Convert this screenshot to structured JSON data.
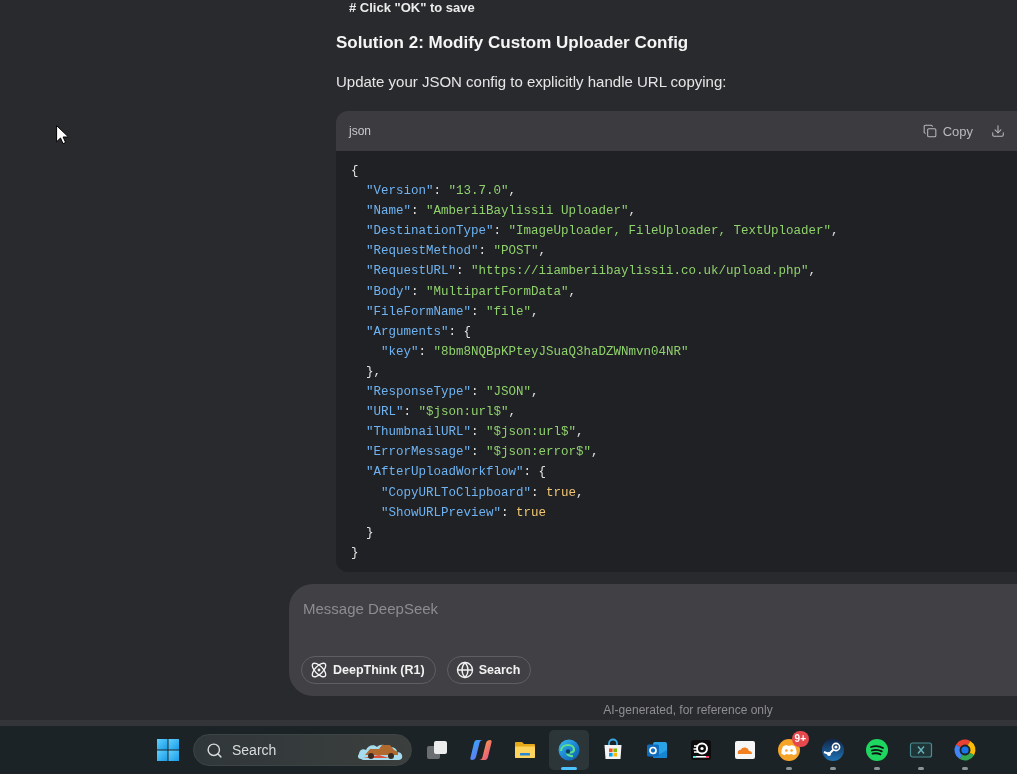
{
  "message": {
    "cut_line": "# Click \"OK\" to save",
    "heading": "Solution 2: Modify Custom Uploader Config",
    "paragraph": "Update your JSON config to explicitly handle URL copying:"
  },
  "code_block": {
    "language": "json",
    "copy_label": "Copy",
    "lines": [
      {
        "tokens": [
          {
            "kind": "punct",
            "text": "{"
          }
        ]
      },
      {
        "tokens": [
          {
            "kind": "key",
            "text": "  \"Version\""
          },
          {
            "kind": "punct",
            "text": ": "
          },
          {
            "kind": "string",
            "text": "\"13.7.0\""
          },
          {
            "kind": "punct",
            "text": ","
          }
        ]
      },
      {
        "tokens": [
          {
            "kind": "key",
            "text": "  \"Name\""
          },
          {
            "kind": "punct",
            "text": ": "
          },
          {
            "kind": "string",
            "text": "\"AmberiiBaylissii Uploader\""
          },
          {
            "kind": "punct",
            "text": ","
          }
        ]
      },
      {
        "tokens": [
          {
            "kind": "key",
            "text": "  \"DestinationType\""
          },
          {
            "kind": "punct",
            "text": ": "
          },
          {
            "kind": "string",
            "text": "\"ImageUploader, FileUploader, TextUploader\""
          },
          {
            "kind": "punct",
            "text": ","
          }
        ]
      },
      {
        "tokens": [
          {
            "kind": "key",
            "text": "  \"RequestMethod\""
          },
          {
            "kind": "punct",
            "text": ": "
          },
          {
            "kind": "string",
            "text": "\"POST\""
          },
          {
            "kind": "punct",
            "text": ","
          }
        ]
      },
      {
        "tokens": [
          {
            "kind": "key",
            "text": "  \"RequestURL\""
          },
          {
            "kind": "punct",
            "text": ": "
          },
          {
            "kind": "string",
            "text": "\"https://iiamberiibaylissii.co.uk/upload.php\""
          },
          {
            "kind": "punct",
            "text": ","
          }
        ]
      },
      {
        "tokens": [
          {
            "kind": "key",
            "text": "  \"Body\""
          },
          {
            "kind": "punct",
            "text": ": "
          },
          {
            "kind": "string",
            "text": "\"MultipartFormData\""
          },
          {
            "kind": "punct",
            "text": ","
          }
        ]
      },
      {
        "tokens": [
          {
            "kind": "key",
            "text": "  \"FileFormName\""
          },
          {
            "kind": "punct",
            "text": ": "
          },
          {
            "kind": "string",
            "text": "\"file\""
          },
          {
            "kind": "punct",
            "text": ","
          }
        ]
      },
      {
        "tokens": [
          {
            "kind": "key",
            "text": "  \"Arguments\""
          },
          {
            "kind": "punct",
            "text": ": {"
          }
        ]
      },
      {
        "tokens": [
          {
            "kind": "key",
            "text": "    \"key\""
          },
          {
            "kind": "punct",
            "text": ": "
          },
          {
            "kind": "string",
            "text": "\"8bm8NQBpKPteyJSuaQ3haDZWNmvn04NR\""
          }
        ]
      },
      {
        "tokens": [
          {
            "kind": "punct",
            "text": "  },"
          }
        ]
      },
      {
        "tokens": [
          {
            "kind": "key",
            "text": "  \"ResponseType\""
          },
          {
            "kind": "punct",
            "text": ": "
          },
          {
            "kind": "string",
            "text": "\"JSON\""
          },
          {
            "kind": "punct",
            "text": ","
          }
        ]
      },
      {
        "tokens": [
          {
            "kind": "key",
            "text": "  \"URL\""
          },
          {
            "kind": "punct",
            "text": ": "
          },
          {
            "kind": "string",
            "text": "\"$json:url$\""
          },
          {
            "kind": "punct",
            "text": ","
          }
        ]
      },
      {
        "tokens": [
          {
            "kind": "key",
            "text": "  \"ThumbnailURL\""
          },
          {
            "kind": "punct",
            "text": ": "
          },
          {
            "kind": "string",
            "text": "\"$json:url$\""
          },
          {
            "kind": "punct",
            "text": ","
          }
        ]
      },
      {
        "tokens": [
          {
            "kind": "key",
            "text": "  \"ErrorMessage\""
          },
          {
            "kind": "punct",
            "text": ": "
          },
          {
            "kind": "string",
            "text": "\"$json:error$\""
          },
          {
            "kind": "punct",
            "text": ","
          }
        ]
      },
      {
        "tokens": [
          {
            "kind": "key",
            "text": "  \"AfterUploadWorkflow\""
          },
          {
            "kind": "punct",
            "text": ": {"
          }
        ]
      },
      {
        "tokens": [
          {
            "kind": "key",
            "text": "    \"CopyURLToClipboard\""
          },
          {
            "kind": "punct",
            "text": ": "
          },
          {
            "kind": "bool",
            "text": "true"
          },
          {
            "kind": "punct",
            "text": ","
          }
        ]
      },
      {
        "tokens": [
          {
            "kind": "key",
            "text": "    \"ShowURLPreview\""
          },
          {
            "kind": "punct",
            "text": ": "
          },
          {
            "kind": "bool",
            "text": "true"
          }
        ]
      },
      {
        "tokens": [
          {
            "kind": "punct",
            "text": "  }"
          }
        ]
      },
      {
        "tokens": [
          {
            "kind": "punct",
            "text": "}"
          }
        ]
      }
    ]
  },
  "composer": {
    "placeholder": "Message DeepSeek",
    "toggles": [
      {
        "label": "DeepThink (R1)",
        "kind": "atom",
        "selected": false
      },
      {
        "label": "Search",
        "kind": "globe",
        "selected": false
      }
    ]
  },
  "disclaimer": "AI-generated, for reference only",
  "taskbar": {
    "search_label": "Search",
    "apps": [
      {
        "kind": "squares",
        "selected": false,
        "running": false
      },
      {
        "kind": "swirl",
        "selected": false,
        "running": false
      },
      {
        "kind": "folder",
        "selected": false,
        "running": false
      },
      {
        "kind": "wave",
        "selected": true,
        "running": true
      },
      {
        "kind": "bag",
        "selected": false,
        "running": false
      },
      {
        "kind": "envelope",
        "selected": false,
        "running": false
      },
      {
        "kind": "disc",
        "selected": false,
        "running": false
      },
      {
        "kind": "cloud",
        "selected": false,
        "running": false
      },
      {
        "kind": "controller",
        "selected": false,
        "running": true,
        "badge": "9+"
      },
      {
        "kind": "piston",
        "selected": false,
        "running": true
      },
      {
        "kind": "waves",
        "selected": false,
        "running": true
      },
      {
        "kind": "xbox",
        "selected": false,
        "running": true
      },
      {
        "kind": "ring",
        "selected": false,
        "running": true
      }
    ]
  }
}
